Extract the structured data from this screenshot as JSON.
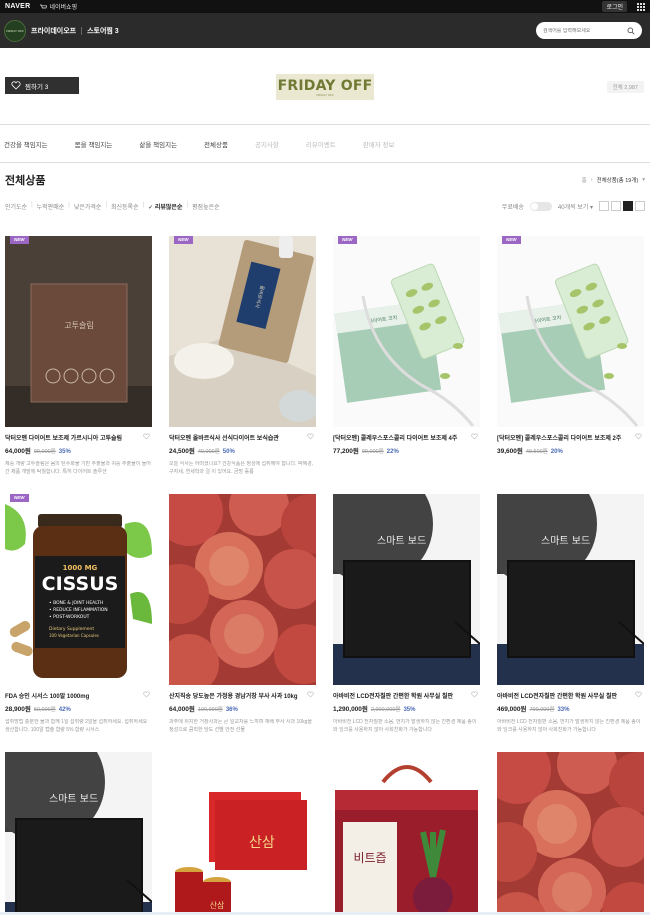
{
  "topbar": {
    "brand": "NAVER",
    "shopping": "네이버쇼핑",
    "login": "로그인"
  },
  "store": {
    "logo_text": "FRIDAY OFF",
    "name": "프라이데이오프",
    "followers": "스토어찜 3",
    "search_placeholder": "검색어를 입력해보세요"
  },
  "banner": {
    "follow_button": "찜하기 3",
    "logo_title": "FRIDAY OFF",
    "logo_sub": "FRIDAY OFF",
    "visitors": "전체 2,987"
  },
  "categories": [
    {
      "label": "건강을 책임지는",
      "dim": false
    },
    {
      "label": "몸을 책임지는",
      "dim": false
    },
    {
      "label": "삶을 책임지는",
      "dim": false
    },
    {
      "label": "전체상품",
      "dim": false
    },
    {
      "label": "공지사항",
      "dim": true
    },
    {
      "label": "리뷰이벤트",
      "dim": true
    },
    {
      "label": "판매자 정보",
      "dim": true
    }
  ],
  "section": {
    "title": "전체상품",
    "breadcrumb_home": "홈",
    "breadcrumb_current": "전체상품(총 19개)"
  },
  "sort": {
    "options": [
      "인기도순",
      "누적판매순",
      "낮은가격순",
      "최신등록순",
      "리뷰많은순",
      "평점높은순"
    ],
    "active_index": 4,
    "free_shipping": "무료배송",
    "page_size": "40개씩 보기"
  },
  "colors": {
    "new_badge": "#9c67c4",
    "discount": "#4a6ab5",
    "store_bar": "#2b2b2b"
  },
  "products": [
    {
      "name": "닥터오멘 다이어트 보조제 가르시니아 고투슬림",
      "price": "64,000원",
      "orig": "99,000원",
      "disc": "35%",
      "new": true,
      "desc": "체중 개량 고투슬림은 몸의 탄수화물 기반 추출물과 귀중 추출물이 들어간 제품 개발에 탁월합니다. 특히 다이어트 솔루션",
      "img": "box"
    },
    {
      "name": "닥터오멘 올바르식사 선식다이어트 보식습관",
      "price": "24,500원",
      "orig": "49,000원",
      "disc": "50%",
      "new": true,
      "desc": "오늘 식사는 어떠셨나요? 건강식품은 정성에 섭취해야 합니다. 박혜경, 구자세, 연세학과 걸 이 있어요. 금방 훌륭",
      "img": "pouch"
    },
    {
      "name": "[닥터오멘] 콜레우스포스콜리 다이어트 보조제 4주",
      "price": "77,200원",
      "orig": "99,000원",
      "disc": "22%",
      "new": true,
      "desc": "",
      "img": "pills"
    },
    {
      "name": "[닥터오멘] 콜레우스포스콜리 다이어트 보조제 2주",
      "price": "39,600원",
      "orig": "49,500원",
      "disc": "20%",
      "new": true,
      "desc": "",
      "img": "pills"
    },
    {
      "name": "FDA 승인 시서스 100알 1000mg",
      "price": "28,900원",
      "orig": "50,000원",
      "disc": "42%",
      "new": true,
      "desc": "섭취방법 충분한 물과 함께 1일 섭취량 2알을 섭취하세요. 섭취하세요 생산합니다. 100알 캡슐 함량 5% 함량 시서스",
      "img": "cissus"
    },
    {
      "name": "산지직송 당도높은 가정용 경남거창 부사 사과 10kg",
      "price": "64,000원",
      "orig": "100,000원",
      "disc": "36%",
      "new": false,
      "desc": "과주에 위치한 거창사과는 큰 일교차를 느끼며 재배 부사 사과 10kg을 정성으로 큼직한 당도 선별 안전 선물",
      "img": "apples"
    },
    {
      "name": "아바비전 LCD전자칠판 간편한 학원 사무실 칠판",
      "price": "1,290,000원",
      "orig": "2,000,000원",
      "disc": "35%",
      "new": false,
      "desc": "아바비전 LCD 전자칠판 소음, 먼지가 발생하지 않는 친환경 제품 종이와 잉크를 사용하지 않아 사회친화가 가능합니다",
      "img": "board"
    },
    {
      "name": "아바비전 LCD전자칠판 간편한 학원 사무실 칠판",
      "price": "469,000원",
      "orig": "700,000원",
      "disc": "33%",
      "new": false,
      "desc": "아바비전 LCD 전자칠판 소음, 먼지가 발생하지 않는 친환경 제품 종이와 잉크를 사용하지 않아 사회친화가 가능합니다",
      "img": "board"
    },
    {
      "name": "",
      "price": "",
      "orig": "",
      "disc": "",
      "new": false,
      "desc": "",
      "img": "board"
    },
    {
      "name": "",
      "price": "",
      "orig": "",
      "disc": "",
      "new": false,
      "desc": "",
      "img": "ginseng"
    },
    {
      "name": "",
      "price": "",
      "orig": "",
      "disc": "",
      "new": false,
      "desc": "",
      "img": "beet"
    },
    {
      "name": "",
      "price": "",
      "orig": "",
      "disc": "",
      "new": false,
      "desc": "",
      "img": "apples"
    }
  ],
  "image_text": {
    "box_label": "고투슬림",
    "pouch_label": "올바르식사",
    "pill_label": "다이어트 코치",
    "cissus_dose": "1000 MG",
    "cissus_brand": "CISSUS",
    "cissus_line1": "• BONE & JOINT HEALTH",
    "cissus_line2": "• REDUCE INFLAMMATION",
    "cissus_line3": "• POST-WORKOUT",
    "cissus_line4": "Dietary Supplement",
    "cissus_line5": "100 Vegetarian Capsules",
    "board_text": "스마트 보드",
    "ginseng_text": "산삼",
    "beet_text": "비트즙"
  }
}
